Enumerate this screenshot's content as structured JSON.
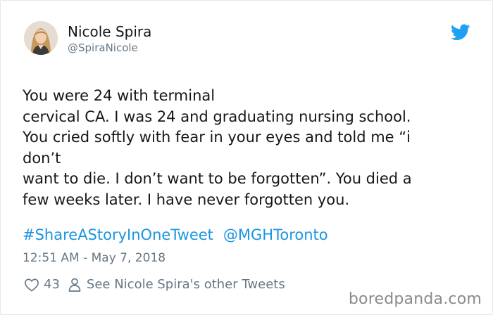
{
  "author": {
    "name": "Nicole Spira",
    "handle": "@SpiraNicole"
  },
  "tweet": {
    "lines": [
      "You were 24 with terminal",
      "cervical CA. I was 24 and graduating nursing school.",
      "You cried softly with fear in your eyes and told me “i",
      "don’t",
      "want to die. I don’t want to be forgotten”. You died a",
      "few weeks later. I have never forgotten you."
    ],
    "hashtag": "#ShareAStoryInOneTweet",
    "mention": "@MGHToronto",
    "timestamp": "12:51 AM - May 7, 2018"
  },
  "actions": {
    "like_count": "43",
    "other_tweets_label": "See Nicole Spira's other Tweets"
  },
  "watermark": "boredpanda.com",
  "colors": {
    "text": "#14171a",
    "muted": "#657786",
    "link": "#1b95e0",
    "twitter_blue": "#1da1f2",
    "border": "#e1e8ed"
  },
  "icons": {
    "brand": "twitter-bird-icon",
    "like": "heart-icon",
    "profile": "person-icon"
  }
}
